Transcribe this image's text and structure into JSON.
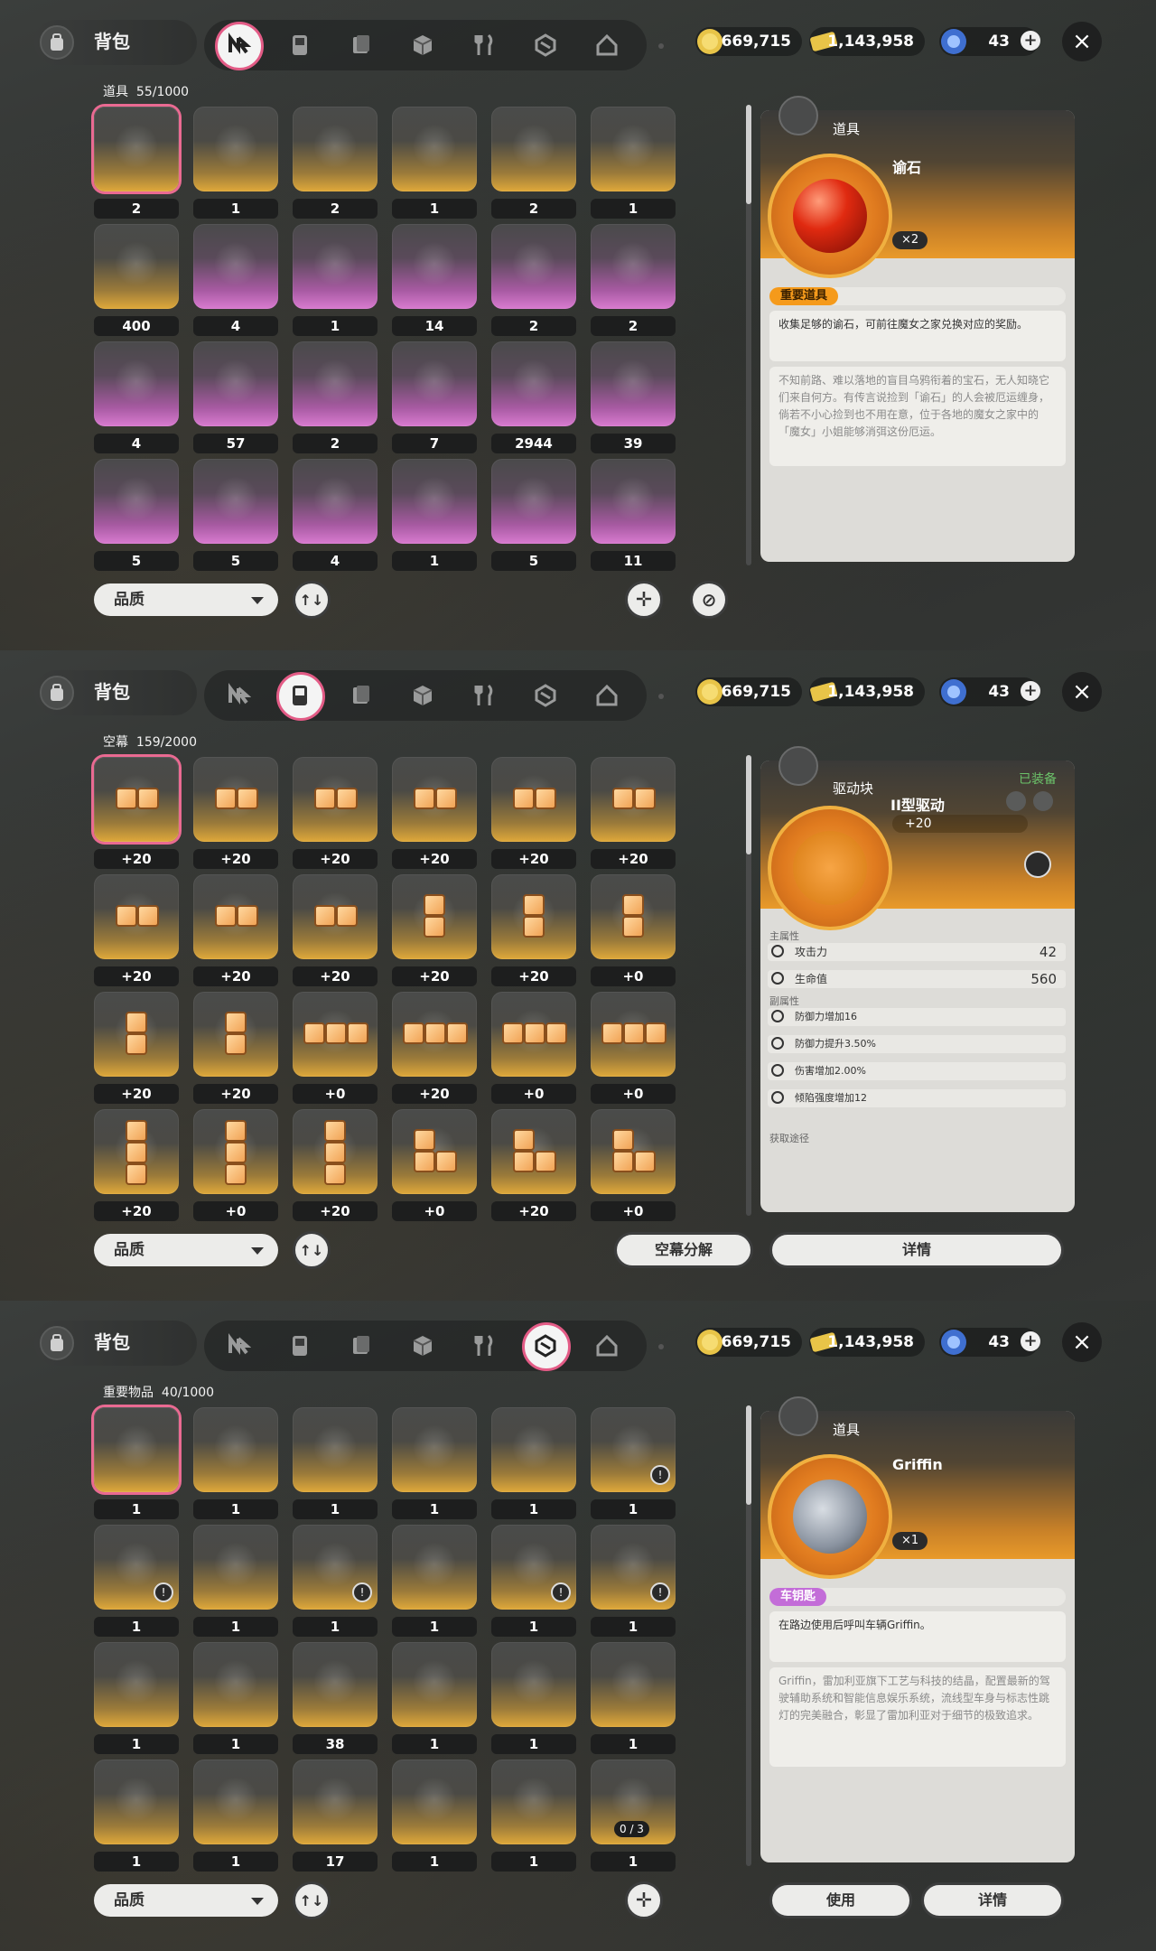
{
  "bag_title": "背包",
  "currency": {
    "gold": "669,715",
    "tickets": "1,143,958",
    "crystals": "43"
  },
  "sort_icon_label": "↑↓",
  "panel1": {
    "section": "道具",
    "count": "55/1000",
    "quality": "品质",
    "grid": [
      {
        "qty": "2",
        "color": "gold"
      },
      {
        "qty": "1",
        "color": "gold"
      },
      {
        "qty": "2",
        "color": "gold"
      },
      {
        "qty": "1",
        "color": "gold"
      },
      {
        "qty": "2",
        "color": "gold"
      },
      {
        "qty": "1",
        "color": "gold"
      },
      {
        "qty": "400",
        "color": "gold"
      },
      {
        "qty": "4",
        "color": "purple"
      },
      {
        "qty": "1",
        "color": "purple"
      },
      {
        "qty": "14",
        "color": "purple"
      },
      {
        "qty": "2",
        "color": "purple"
      },
      {
        "qty": "2",
        "color": "purple"
      },
      {
        "qty": "4",
        "color": "purple"
      },
      {
        "qty": "57",
        "color": "purple"
      },
      {
        "qty": "2",
        "color": "purple"
      },
      {
        "qty": "7",
        "color": "purple"
      },
      {
        "qty": "2944",
        "color": "purple"
      },
      {
        "qty": "39",
        "color": "purple"
      },
      {
        "qty": "5",
        "color": "purple"
      },
      {
        "qty": "5",
        "color": "purple"
      },
      {
        "qty": "4",
        "color": "purple"
      },
      {
        "qty": "1",
        "color": "purple"
      },
      {
        "qty": "5",
        "color": "purple"
      },
      {
        "qty": "11",
        "color": "purple"
      }
    ],
    "card": {
      "category": "道具",
      "name": "谕石",
      "qty": "×2",
      "tag": "重要道具",
      "desc": "收集足够的谕石，可前往魔女之家兑换对应的奖励。",
      "lore": "不知前路、难以落地的盲目乌鸦衔着的宝石，无人知晓它们来自何方。有传言说捡到「谕石」的人会被厄运缠身，倘若不小心捡到也不用在意，位于各地的魔女之家中的「魔女」小姐能够消弭这份厄运。"
    }
  },
  "panel2": {
    "section": "空幕",
    "count": "159/2000",
    "quality": "品质",
    "decompose": "空幕分解",
    "details": "详情",
    "grid_values": [
      "+20",
      "+20",
      "+20",
      "+20",
      "+20",
      "+20",
      "+20",
      "+20",
      "+20",
      "+20",
      "+20",
      "+0",
      "+20",
      "+20",
      "+0",
      "+20",
      "+0",
      "+0",
      "+20",
      "+0",
      "+20",
      "+0",
      "+20",
      "+0"
    ],
    "card": {
      "category": "驱动块",
      "equipped": "已装备",
      "name": "II型驱动",
      "level": "+20",
      "main_attr_header": "主属性",
      "sub_attr_header": "副属性",
      "source_header": "获取途径",
      "main_stats": [
        {
          "label": "攻击力",
          "value": "42"
        },
        {
          "label": "生命值",
          "value": "560"
        }
      ],
      "sub_stats": [
        {
          "label": "防御力增加16"
        },
        {
          "label": "防御力提升3.50%"
        },
        {
          "label": "伤害增加2.00%"
        },
        {
          "label": "倾陷强度增加12"
        }
      ]
    }
  },
  "panel3": {
    "section": "重要物品",
    "count": "40/1000",
    "quality": "品质",
    "use": "使用",
    "details": "详情",
    "grid": [
      {
        "qty": "1"
      },
      {
        "qty": "1"
      },
      {
        "qty": "1"
      },
      {
        "qty": "1"
      },
      {
        "qty": "1"
      },
      {
        "qty": "1"
      },
      {
        "qty": "1"
      },
      {
        "qty": "1"
      },
      {
        "qty": "1"
      },
      {
        "qty": "1"
      },
      {
        "qty": "1"
      },
      {
        "qty": "1"
      },
      {
        "qty": "1"
      },
      {
        "qty": "1"
      },
      {
        "qty": "38"
      },
      {
        "qty": "1"
      },
      {
        "qty": "1"
      },
      {
        "qty": "1"
      },
      {
        "qty": "1"
      },
      {
        "qty": "1"
      },
      {
        "qty": "17"
      },
      {
        "qty": "1"
      },
      {
        "qty": "1"
      },
      {
        "qty": "1"
      }
    ],
    "progress_label": "0 / 3",
    "card": {
      "category": "道具",
      "name": "Griffin",
      "qty": "×1",
      "tag": "车钥匙",
      "desc": "在路边使用后呼叫车辆Griffin。",
      "lore": "Griffin，雷加利亚旗下工艺与科技的结晶，配置最新的驾驶辅助系统和智能信息娱乐系统，流线型车身与标志性跳灯的完美融合，彰显了雷加利亚对于细节的极致追求。"
    }
  },
  "colors": {
    "accent_pink": "#e35b86",
    "gold_tag": "#f59a1b",
    "purple_tag": "#c36dd8"
  },
  "icons": [
    "backpack-icon",
    "nethra-tab-icon",
    "drive-disc-tab-icon",
    "docs-tab-icon",
    "box-tab-icon",
    "food-tab-icon",
    "key-items-tab-icon",
    "home-tab-icon"
  ]
}
